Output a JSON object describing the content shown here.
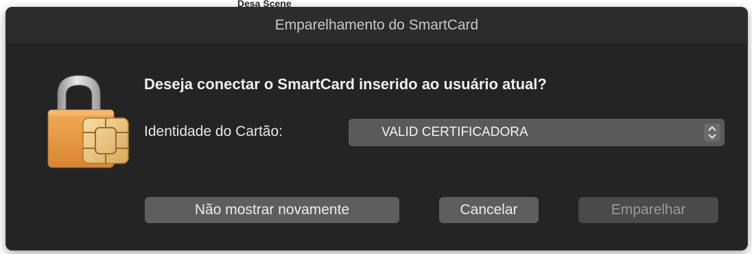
{
  "background": {
    "peek_text": "Desa Scene"
  },
  "dialog": {
    "title": "Emparelhamento do SmartCard",
    "message": "Deseja conectar o SmartCard inserido ao usuário atual?",
    "identity_label": "Identidade do Cartão:",
    "identity_select": {
      "selected": "VALID CERTIFICADORA"
    },
    "buttons": {
      "dont_show_again": "Não mostrar novamente",
      "cancel": "Cancelar",
      "pair": "Emparelhar"
    },
    "icon": "padlock-smartcard-chip-icon"
  },
  "colors": {
    "dialog_bg": "#242424",
    "titlebar_bg": "#2c2c2c",
    "button_bg": "#5e5e5e",
    "disabled_button_bg": "#4a4a4a",
    "lock_body": "#e79a45",
    "chip_gold": "#f0c980"
  }
}
